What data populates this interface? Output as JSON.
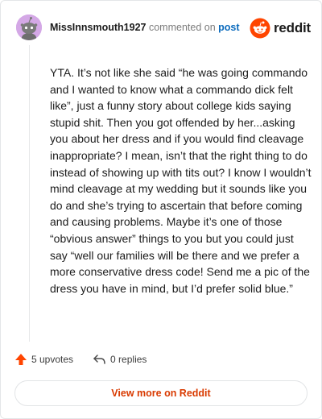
{
  "comment": {
    "username": "MissInnsmouth1927",
    "action_text": "commented on",
    "post_link": "post",
    "body": "YTA. It’s not like she said “he was going commando and I wanted to know what a commando dick felt like”, just a funny story about college kids saying stupid shit. Then you got offended by her...asking you about her dress and if you would find cleavage inappropriate? I mean, isn’t that the right thing to do instead of showing up with tits out? I know I wouldn’t mind cleavage at my wedding but it sounds like you do and she’s trying to ascertain that before coming and causing problems. Maybe it’s one of those “obvious answer” things to you but you could just say “well our families will be there and we prefer a more conservative dress code! Send me a pic of the dress you have in mind, but I’d prefer solid blue.”"
  },
  "brand": {
    "logo_text": "reddit",
    "logo_icon": "reddit-snoo-icon"
  },
  "stats": {
    "upvotes": "5 upvotes",
    "replies": "0 replies",
    "upvote_icon": "upvote-arrow-icon",
    "reply_icon": "reply-arrow-icon"
  },
  "footer": {
    "view_more_label": "View more on Reddit"
  },
  "colors": {
    "avatar_bg": "#d4a8e6",
    "brand_orange": "#ff4500",
    "link_blue": "#0b6bbd",
    "button_text": "#d93a00"
  }
}
